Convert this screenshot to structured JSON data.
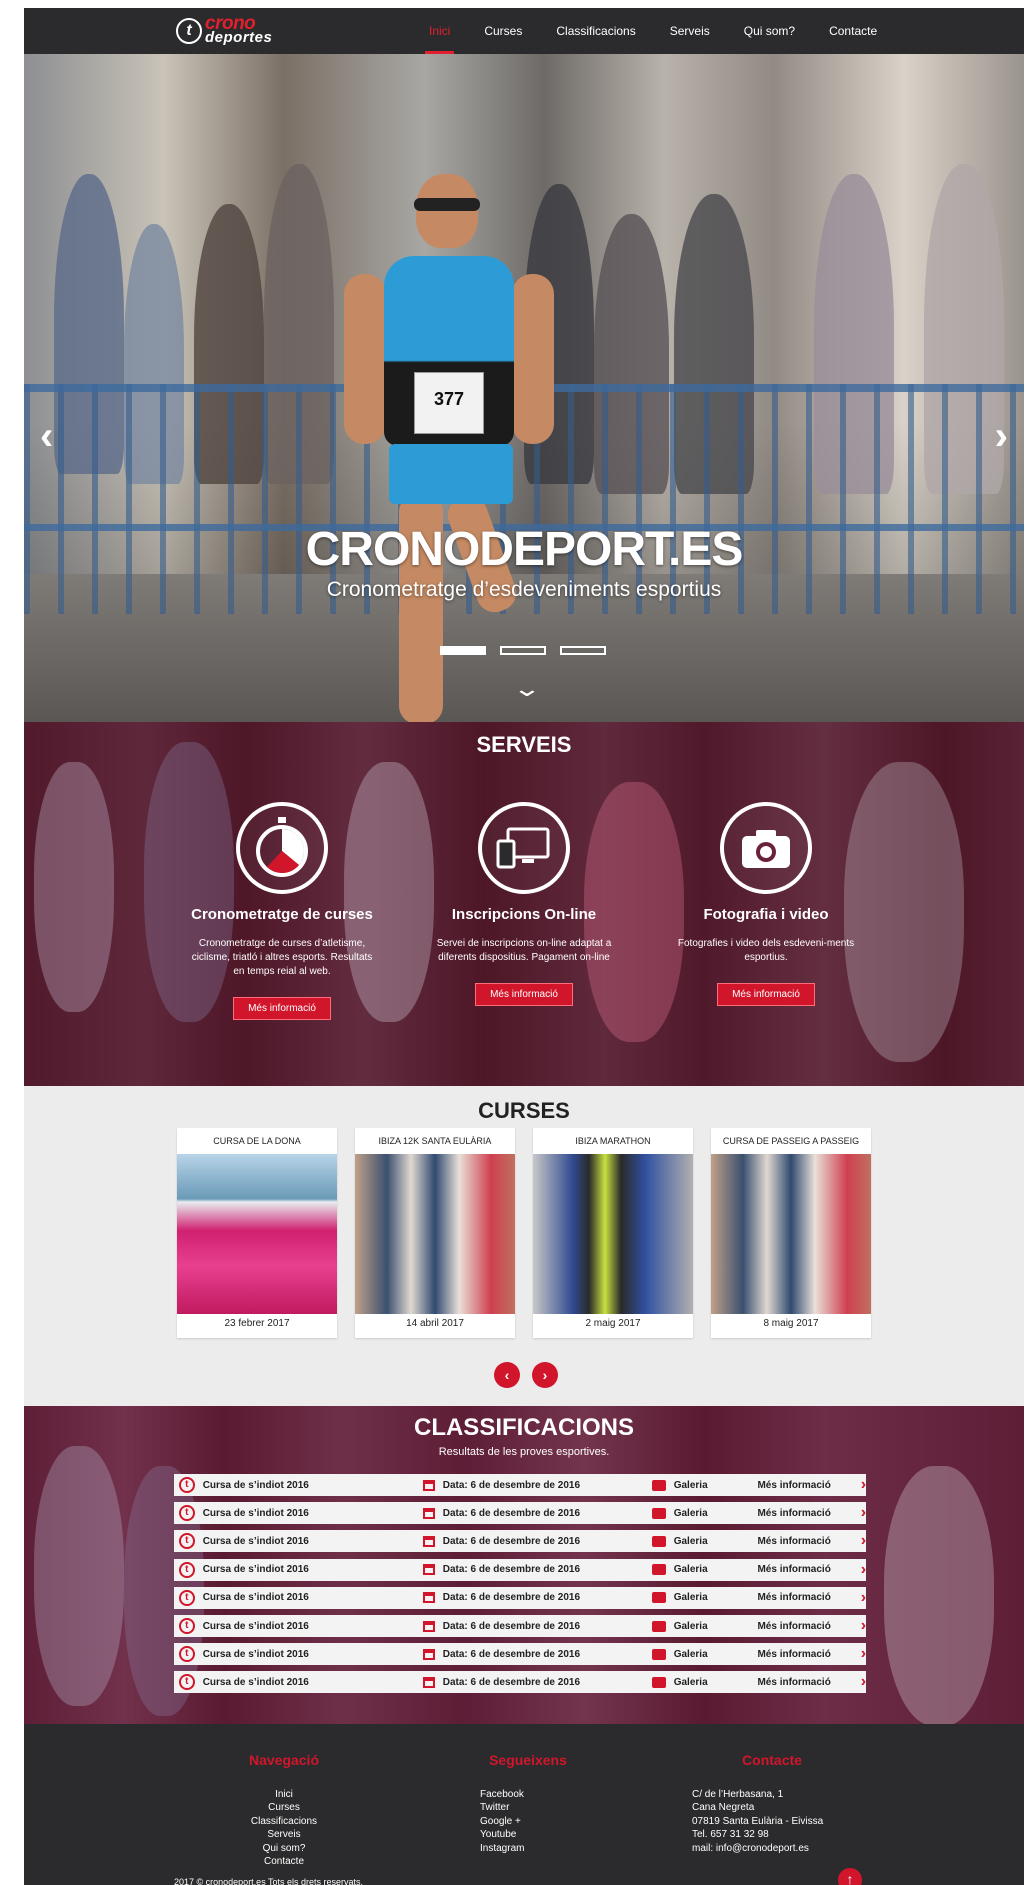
{
  "nav": {
    "logo_line1": "crono",
    "logo_line2": "deportes",
    "logo_mark": "t",
    "items": [
      "Inici",
      "Curses",
      "Classificacions",
      "Serveis",
      "Qui som?",
      "Contacte"
    ],
    "active_item": "Inici"
  },
  "hero": {
    "title": "CRONODEPORT.ES",
    "subtitle": "Cronometratge d’esdeveniments esportius",
    "bib_number": "377",
    "slides": 3,
    "active_slide": 1,
    "prev_icon": "chevron-left-icon",
    "next_icon": "chevron-right-icon",
    "down_icon": "chevron-down-icon"
  },
  "serveis": {
    "title": "SERVEIS",
    "items": [
      {
        "icon": "stopwatch-icon",
        "name": "Cronometratge de curses",
        "desc": "Cronometratge de curses d’atletisme, ciclisme, triatló i altres esports. Resultats en temps reial al web.",
        "button": "Més informació"
      },
      {
        "icon": "devices-icon",
        "name": "Inscripcions On-line",
        "desc": "Servei de inscripcions on-line adaptat a diferents dispositius. Pagament on-line",
        "button": "Més informació"
      },
      {
        "icon": "camera-icon",
        "name": "Fotografia i video",
        "desc": "Fotografies i video dels esdeveni-ments esportius.",
        "button": "Més informació"
      }
    ]
  },
  "curses": {
    "title": "CURSES",
    "cards": [
      {
        "title": "CURSA DE LA DONA",
        "date": "23 febrer 2017"
      },
      {
        "title": "IBIZA 12K SANTA EULÀRIA",
        "date": "14 abril 2017"
      },
      {
        "title": "IBIZA MARATHON",
        "date": "2  maig 2017"
      },
      {
        "title": "CURSA DE PASSEIG A PASSEIG",
        "date": "8 maig 2017"
      }
    ],
    "prev_icon": "chevron-left-icon",
    "next_icon": "chevron-right-icon"
  },
  "classificacions": {
    "title": "CLASSIFICACIONS",
    "subtitle": "Resultats de les proves esportives.",
    "rows": [
      {
        "name": "Cursa de s’indiot   2016",
        "date": "Data: 6 de desembre de 2016",
        "gallery": "Galeria",
        "more": "Més informació"
      },
      {
        "name": "Cursa de s’indiot   2016",
        "date": "Data: 6 de desembre de 2016",
        "gallery": "Galeria",
        "more": "Més informació"
      },
      {
        "name": "Cursa de s’indiot   2016",
        "date": "Data: 6 de desembre de 2016",
        "gallery": "Galeria",
        "more": "Més informació"
      },
      {
        "name": "Cursa de s’indiot   2016",
        "date": "Data: 6 de desembre de 2016",
        "gallery": "Galeria",
        "more": "Més informació"
      },
      {
        "name": "Cursa de s’indiot   2016",
        "date": "Data: 6 de desembre de 2016",
        "gallery": "Galeria",
        "more": "Més informació"
      },
      {
        "name": "Cursa de s’indiot   2016",
        "date": "Data: 6 de desembre de 2016",
        "gallery": "Galeria",
        "more": "Més informació"
      },
      {
        "name": "Cursa de s’indiot   2016",
        "date": "Data: 6 de desembre de 2016",
        "gallery": "Galeria",
        "more": "Més informació"
      },
      {
        "name": "Cursa de s’indiot   2016",
        "date": "Data: 6 de desembre de 2016",
        "gallery": "Galeria",
        "more": "Més informació"
      }
    ]
  },
  "footer": {
    "nav_title": "Navegació",
    "nav_links": [
      "Inici",
      "Curses",
      "Classificacions",
      "Serveis",
      "Qui som?",
      "Contacte"
    ],
    "follow_title": "Segueixens",
    "follow_links": [
      "Facebook",
      "Twitter",
      "Google +",
      "Youtube",
      "Instagram"
    ],
    "contact_title": "Contacte",
    "contact_lines": [
      "C/ de l’Herbasana, 1",
      "Cana Negreta",
      "07819 Santa Eulària - Eivissa",
      "Tel. 657 31 32 98",
      "mail: info@cronodeport.es"
    ],
    "copyright": "2017 © cronodeport.es Tots els drets reservats.",
    "to_top_icon": "arrow-up-icon"
  },
  "colors": {
    "accent": "#d1162b",
    "nav_bg": "#2b2b2d",
    "section_bg": "#ececec"
  }
}
